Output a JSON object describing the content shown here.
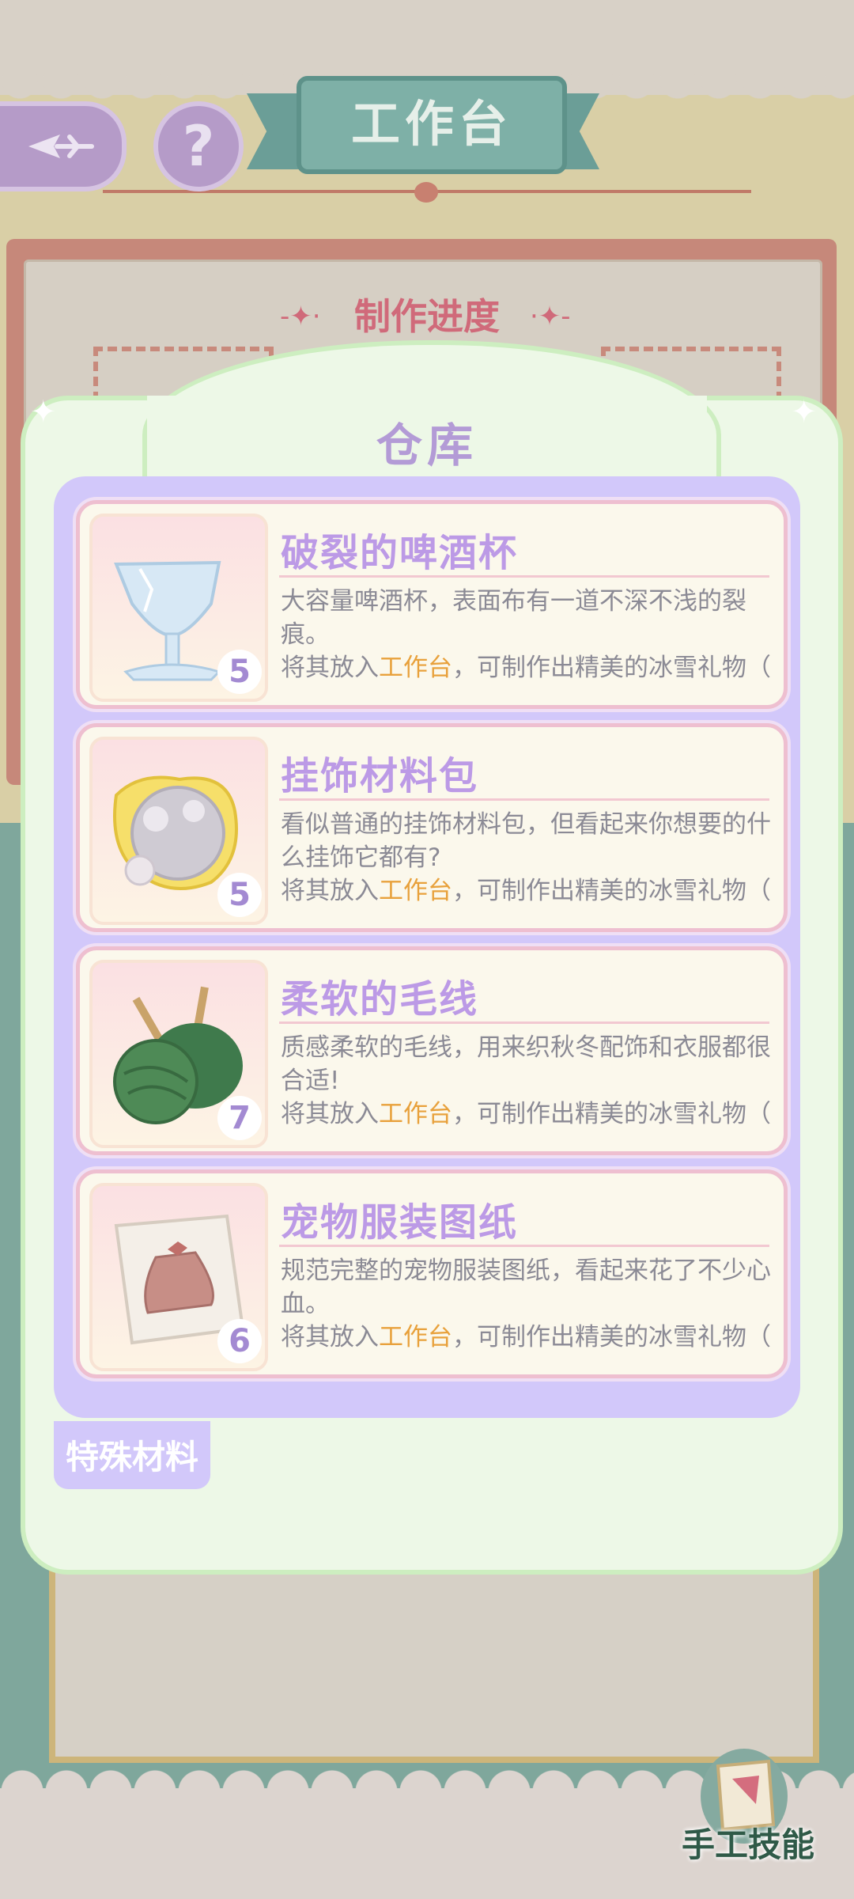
{
  "header": {
    "title": "工作台",
    "help_glyph": "?"
  },
  "progress": {
    "title": "制作进度"
  },
  "warehouse": {
    "title": "仓库",
    "items": [
      {
        "name": "破裂的啤酒杯",
        "count": "5",
        "description": "大容量啤酒杯，表面布有一道不深不浅的裂痕。",
        "use_prefix": "将其放入",
        "use_highlight": "工作台",
        "use_suffix": "，可制作出精美的冰雪礼物（",
        "icon": "cracked-glass-icon"
      },
      {
        "name": "挂饰材料包",
        "count": "5",
        "description": "看似普通的挂饰材料包，但看起来你想要的什么挂饰它都有?",
        "use_prefix": "将其放入",
        "use_highlight": "工作台",
        "use_suffix": "，可制作出精美的冰雪礼物（",
        "icon": "material-pouch-icon"
      },
      {
        "name": "柔软的毛线",
        "count": "7",
        "description": "质感柔软的毛线，用来织秋冬配饰和衣服都很合适!",
        "use_prefix": "将其放入",
        "use_highlight": "工作台",
        "use_suffix": "，可制作出精美的冰雪礼物（",
        "icon": "yarn-icon"
      },
      {
        "name": "宠物服装图纸",
        "count": "6",
        "description": "规范完整的宠物服装图纸，看起来花了不少心血。",
        "use_prefix": "将其放入",
        "use_highlight": "工作台",
        "use_suffix": "，可制作出精美的冰雪礼物（",
        "icon": "pattern-paper-icon"
      }
    ],
    "tab": "特殊材料"
  },
  "footer": {
    "skill_label": "手工技能"
  },
  "colors": {
    "accent_purple": "#bc9ae6",
    "highlight_orange": "#e8a13c",
    "ribbon_teal": "#7eb0a7"
  }
}
